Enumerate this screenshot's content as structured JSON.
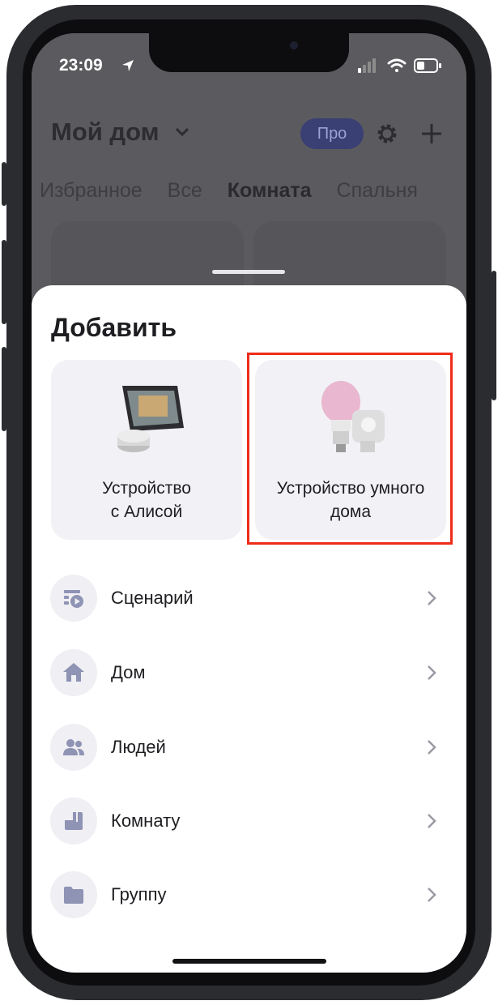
{
  "status_bar": {
    "time": "23:09"
  },
  "header": {
    "title": "Мой дом",
    "pro_badge": "Про"
  },
  "tabs": [
    {
      "label": "Избранное"
    },
    {
      "label": "Все"
    },
    {
      "label": "Комната",
      "active": true
    },
    {
      "label": "Спальня"
    }
  ],
  "sheet": {
    "title": "Добавить",
    "tiles": [
      {
        "label_line1": "Устройство",
        "label_line2": "с Алисой",
        "icon": "smart-speaker-image"
      },
      {
        "label_line1": "Устройство умного",
        "label_line2": "дома",
        "icon": "smart-bulb-plug-image"
      }
    ],
    "items": [
      {
        "label": "Сценарий",
        "icon": "scenario-icon"
      },
      {
        "label": "Дом",
        "icon": "house-icon"
      },
      {
        "label": "Людей",
        "icon": "people-icon"
      },
      {
        "label": "Комнату",
        "icon": "room-icon"
      },
      {
        "label": "Группу",
        "icon": "folder-icon"
      }
    ]
  },
  "colors": {
    "highlight": "#ef2c1a",
    "icon_tint": "#8f93b4",
    "pro_badge_bg": "#3a3f74"
  }
}
